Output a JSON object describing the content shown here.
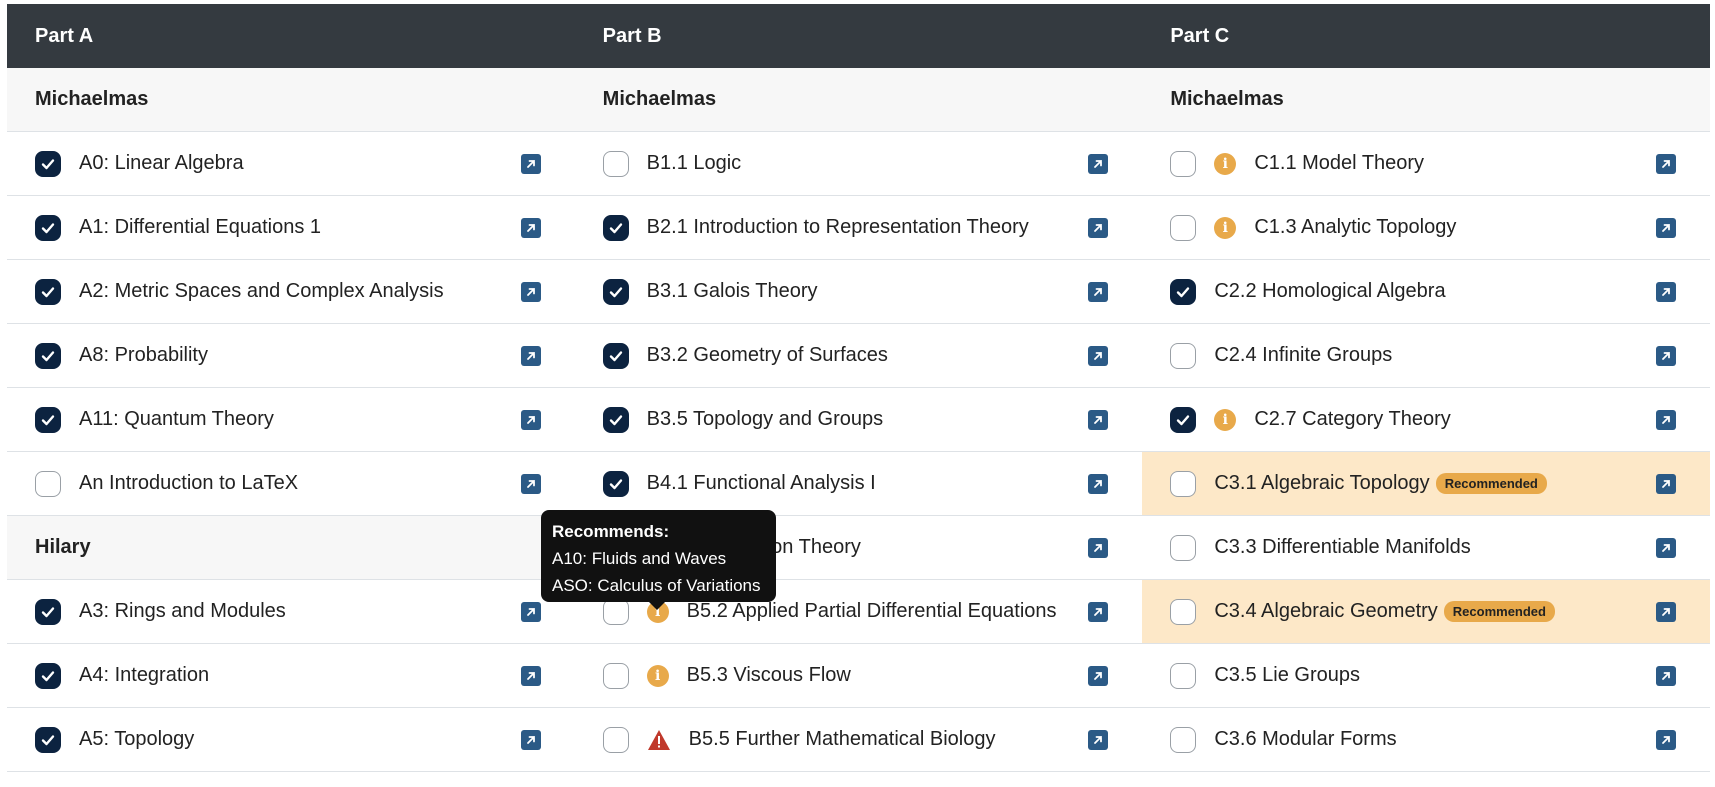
{
  "header": [
    "Part A",
    "Part B",
    "Part C"
  ],
  "columns": [
    [
      {
        "type": "term",
        "label": "Michaelmas"
      },
      {
        "label": "A0: Linear Algebra",
        "checked": true
      },
      {
        "label": "A1: Differential Equations 1",
        "checked": true
      },
      {
        "label": "A2: Metric Spaces and Complex Analysis",
        "checked": true
      },
      {
        "label": "A8: Probability",
        "checked": true
      },
      {
        "label": "A11: Quantum Theory",
        "checked": true
      },
      {
        "label": "An Introduction to LaTeX",
        "checked": false
      },
      {
        "type": "term",
        "label": "Hilary"
      },
      {
        "label": "A3: Rings and Modules",
        "checked": true
      },
      {
        "label": "A4: Integration",
        "checked": true
      },
      {
        "label": "A5: Topology",
        "checked": true
      }
    ],
    [
      {
        "type": "term",
        "label": "Michaelmas"
      },
      {
        "label": "B1.1 Logic",
        "checked": false
      },
      {
        "label": "B2.1 Introduction to Representation Theory",
        "checked": true
      },
      {
        "label": "B3.1 Galois Theory",
        "checked": true
      },
      {
        "label": "B3.2 Geometry of Surfaces",
        "checked": true
      },
      {
        "label": "B3.5 Topology and Groups",
        "checked": true
      },
      {
        "label": "B4.1 Functional Analysis I",
        "checked": true
      },
      {
        "label": "B4.3 Distribution Theory",
        "checked": false
      },
      {
        "label": "B5.2 Applied Partial Differential Equations",
        "checked": false,
        "icon": "info"
      },
      {
        "label": "B5.3 Viscous Flow",
        "checked": false,
        "icon": "info"
      },
      {
        "label": "B5.5 Further Mathematical Biology",
        "checked": false,
        "icon": "warning"
      }
    ],
    [
      {
        "type": "term",
        "label": "Michaelmas"
      },
      {
        "label": "C1.1 Model Theory",
        "checked": false,
        "icon": "info"
      },
      {
        "label": "C1.3 Analytic Topology",
        "checked": false,
        "icon": "info"
      },
      {
        "label": "C2.2 Homological Algebra",
        "checked": true
      },
      {
        "label": "C2.4 Infinite Groups",
        "checked": false
      },
      {
        "label": "C2.7 Category Theory",
        "checked": true,
        "icon": "info"
      },
      {
        "label": "C3.1 Algebraic Topology",
        "checked": false,
        "badge": "Recommended"
      },
      {
        "label": "C3.3 Differentiable Manifolds",
        "checked": false
      },
      {
        "label": "C3.4 Algebraic Geometry",
        "checked": false,
        "badge": "Recommended"
      },
      {
        "label": "C3.5 Lie Groups",
        "checked": false
      },
      {
        "label": "C3.6 Modular Forms",
        "checked": false
      }
    ]
  ],
  "tooltip": {
    "title": "Recommends:",
    "lines": [
      "A10: Fluids and Waves",
      "ASO: Calculus of Variations"
    ]
  },
  "colors": {
    "header_bg": "#343a40",
    "checkbox_on": "#0c2340",
    "info": "#e8a94a",
    "warning": "#c0392b",
    "recommended_row": "#fde8c8",
    "link_icon": "#2b5a86"
  }
}
